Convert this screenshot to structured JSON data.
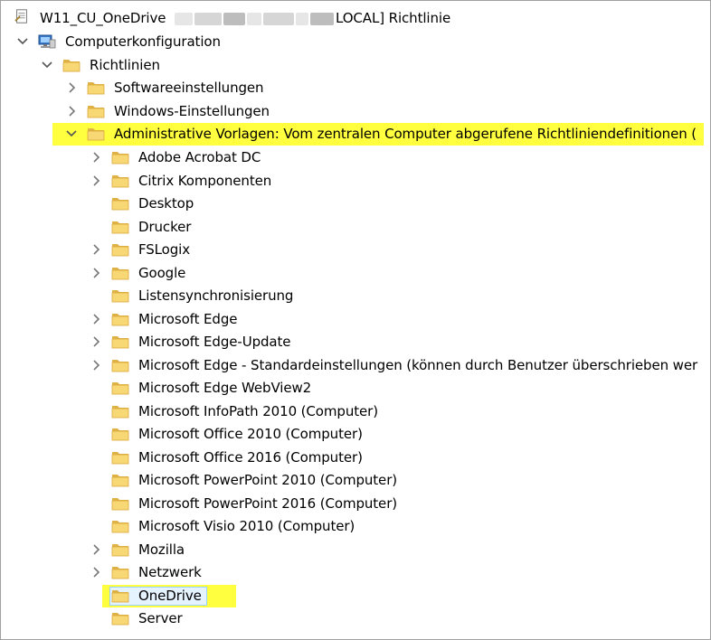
{
  "window": {
    "title_prefix": "W11_CU_OneDrive",
    "title_suffix": "LOCAL] Richtlinie"
  },
  "colors": {
    "highlight": "#ffff40",
    "folder_body": "#f8d775",
    "folder_tab": "#e0b146",
    "selection_border": "#99d1ff",
    "selection_fill": "#e5f3ff",
    "chevron": "#555555"
  },
  "tree": {
    "root_label": "Computerkonfiguration",
    "policies_label": "Richtlinien",
    "software_label": "Softwareeinstellungen",
    "windows_label": "Windows-Einstellungen",
    "admin_label": "Administrative Vorlagen: Vom zentralen Computer abgerufene Richtliniendefinitionen (",
    "items": [
      {
        "label": "Adobe Acrobat DC",
        "expandable": true
      },
      {
        "label": "Citrix Komponenten",
        "expandable": true
      },
      {
        "label": "Desktop",
        "expandable": false
      },
      {
        "label": "Drucker",
        "expandable": false
      },
      {
        "label": "FSLogix",
        "expandable": true
      },
      {
        "label": "Google",
        "expandable": true
      },
      {
        "label": "Listensynchronisierung",
        "expandable": false
      },
      {
        "label": "Microsoft Edge",
        "expandable": true
      },
      {
        "label": "Microsoft Edge-Update",
        "expandable": true
      },
      {
        "label": "Microsoft Edge - Standardeinstellungen (können durch Benutzer überschrieben wer",
        "expandable": true
      },
      {
        "label": "Microsoft Edge WebView2",
        "expandable": false
      },
      {
        "label": "Microsoft InfoPath 2010 (Computer)",
        "expandable": false
      },
      {
        "label": "Microsoft Office 2010 (Computer)",
        "expandable": false
      },
      {
        "label": "Microsoft Office 2016 (Computer)",
        "expandable": false
      },
      {
        "label": "Microsoft PowerPoint 2010 (Computer)",
        "expandable": false
      },
      {
        "label": "Microsoft PowerPoint 2016 (Computer)",
        "expandable": false
      },
      {
        "label": "Microsoft Visio 2010 (Computer)",
        "expandable": false
      },
      {
        "label": "Mozilla",
        "expandable": true
      },
      {
        "label": "Netzwerk",
        "expandable": true
      },
      {
        "label": "OneDrive",
        "expandable": false,
        "selected": true,
        "highlighted": true
      },
      {
        "label": "Server",
        "expandable": false
      }
    ]
  }
}
